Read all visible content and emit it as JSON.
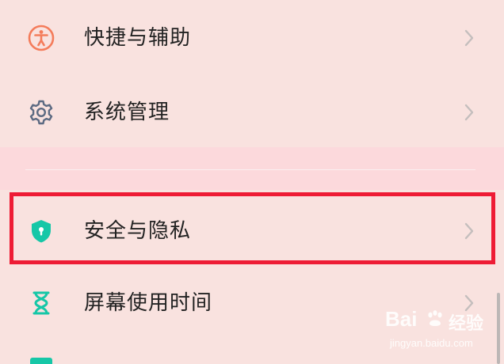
{
  "settings_list": {
    "items": [
      {
        "label": "快捷与辅助",
        "icon": "accessibility-icon",
        "icon_color": "#f47c5b"
      },
      {
        "label": "系统管理",
        "icon": "gear-icon",
        "icon_color": "#5c6a82"
      },
      {
        "label": "安全与隐私",
        "icon": "shield-icon",
        "icon_color": "#16c7a7",
        "highlighted": true
      },
      {
        "label": "屏幕使用时间",
        "icon": "hourglass-icon",
        "icon_color": "#16c7a7"
      }
    ],
    "highlight_color": "#ee1c35"
  },
  "watermark": {
    "brand": "Bai",
    "brand_suffix": "经验",
    "url": "jingyan.baidu.com"
  }
}
